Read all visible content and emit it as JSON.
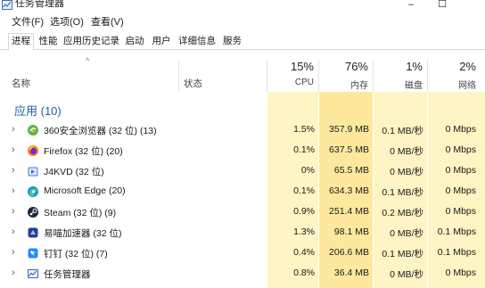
{
  "window": {
    "title": "任务管理器",
    "minimize": "–",
    "maximize": "☐"
  },
  "menu": [
    "文件(F)",
    "选项(O)",
    "查看(V)"
  ],
  "tabs": [
    "进程",
    "性能",
    "应用历史记录",
    "启动",
    "用户",
    "详细信息",
    "服务"
  ],
  "header": {
    "sort_indicator": "^",
    "name": "名称",
    "status": "状态",
    "cpu": {
      "percent": "15%",
      "label": "CPU"
    },
    "memory": {
      "percent": "76%",
      "label": "内存"
    },
    "disk": {
      "percent": "1%",
      "label": "磁盘"
    },
    "network": {
      "percent": "2%",
      "label": "网络"
    }
  },
  "group": {
    "label": "应用 (10)"
  },
  "colors": {
    "metric_light": "#fff4c4",
    "metric_mid": "#ffe8a0",
    "metric_dark": "#fcdc83",
    "group_label": "#1f5ea8"
  },
  "processes": [
    {
      "expand": "›",
      "icon": "360-browser-icon",
      "name": "360安全浏览器 (32 位) (13)",
      "cpu": "1.5%",
      "memory": "357.9 MB",
      "disk": "0.1 MB/秒",
      "network": "0 Mbps"
    },
    {
      "expand": "›",
      "icon": "firefox-icon",
      "name": "Firefox (32 位) (20)",
      "cpu": "0.1%",
      "memory": "637.5 MB",
      "disk": "0 MB/秒",
      "network": "0 Mbps"
    },
    {
      "expand": "›",
      "icon": "j4kvd-icon",
      "name": "J4KVD (32 位)",
      "cpu": "0%",
      "memory": "65.5 MB",
      "disk": "0 MB/秒",
      "network": "0 Mbps"
    },
    {
      "expand": "›",
      "icon": "edge-icon",
      "name": "Microsoft Edge (20)",
      "cpu": "0.1%",
      "memory": "634.3 MB",
      "disk": "0.1 MB/秒",
      "network": "0 Mbps"
    },
    {
      "expand": "›",
      "icon": "steam-icon",
      "name": "Steam (32 位) (9)",
      "cpu": "0.9%",
      "memory": "251.4 MB",
      "disk": "0.2 MB/秒",
      "network": "0 Mbps"
    },
    {
      "expand": "›",
      "icon": "accelerator-icon",
      "name": "易喵加速器 (32 位)",
      "cpu": "1.3%",
      "memory": "98.1 MB",
      "disk": "0 MB/秒",
      "network": "0.1 Mbps"
    },
    {
      "expand": "›",
      "icon": "dingtalk-icon",
      "name": "钉钉 (32 位) (7)",
      "cpu": "0.4%",
      "memory": "206.6 MB",
      "disk": "0.1 MB/秒",
      "network": "0.1 Mbps"
    },
    {
      "expand": "›",
      "icon": "task-manager-icon",
      "name": "任务管理器",
      "cpu": "0.8%",
      "memory": "36.4 MB",
      "disk": "0 MB/秒",
      "network": "0 Mbps"
    }
  ]
}
